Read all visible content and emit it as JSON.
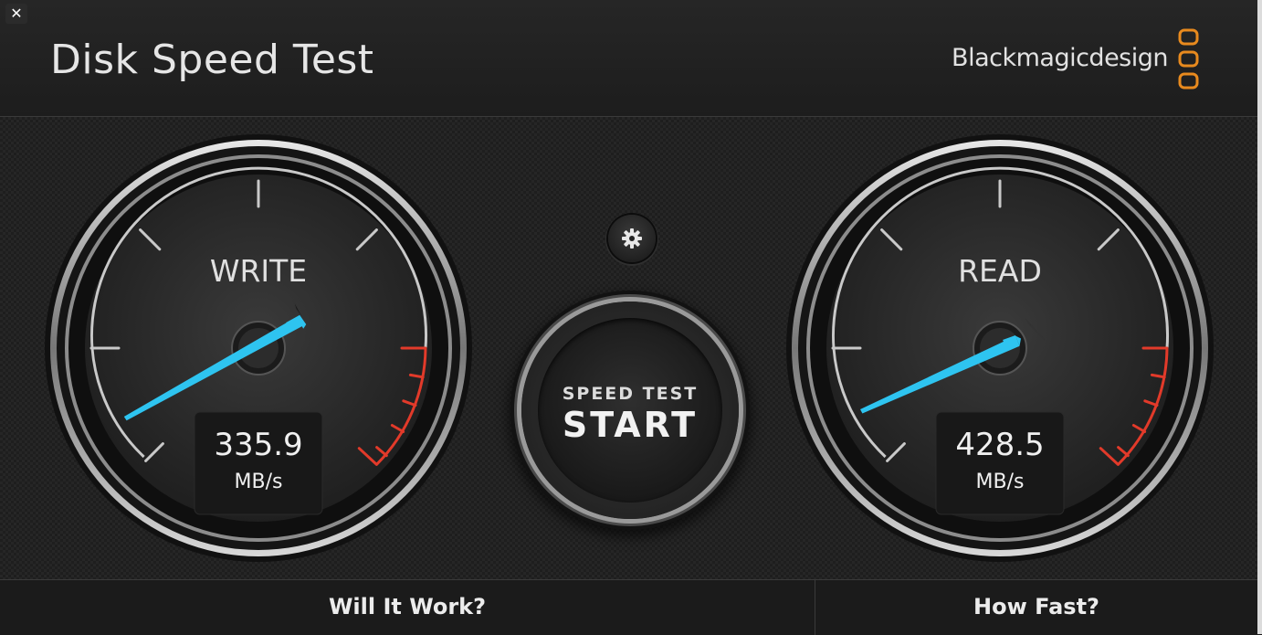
{
  "window": {
    "title": "Disk Speed Test",
    "close_symbol": "✕",
    "brand": "Blackmagicdesign",
    "brand_icon": "blackmagic-logo-icon",
    "accent_color": "#e88a1e"
  },
  "gauges": {
    "write": {
      "label": "WRITE",
      "value": "335.9",
      "unit": "MB/s",
      "needle_color": "#2ec4f0",
      "danger_color": "#e23a2a"
    },
    "read": {
      "label": "READ",
      "value": "428.5",
      "unit": "MB/s",
      "needle_color": "#2ec4f0",
      "danger_color": "#e23a2a"
    }
  },
  "controls": {
    "settings_icon": "gear-icon",
    "start_sub": "SPEED TEST",
    "start_main": "START"
  },
  "footer": {
    "will_it_work": "Will It Work?",
    "how_fast": "How Fast?"
  }
}
